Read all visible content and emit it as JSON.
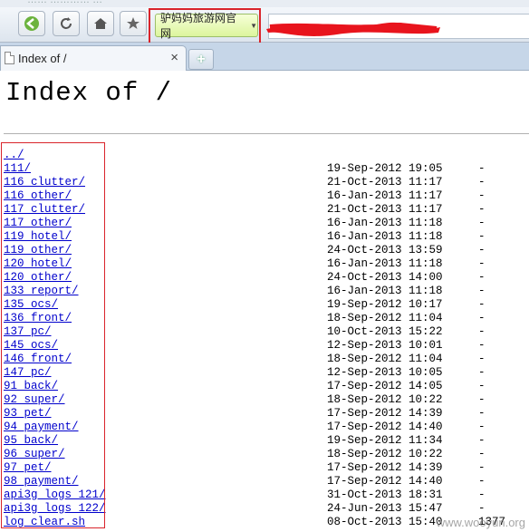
{
  "browser": {
    "window_title_fragment": "…… ………… …",
    "bookmark_label": "驴妈妈旅游网官网",
    "tab_title": "Index of /",
    "close_glyph": "×",
    "newtab_glyph": "+"
  },
  "page": {
    "heading": "Index of /",
    "entries": [
      {
        "name": "../",
        "date": "",
        "size": ""
      },
      {
        "name": "111/",
        "date": "19-Sep-2012 19:05",
        "size": "-"
      },
      {
        "name": "116_clutter/",
        "date": "21-Oct-2013 11:17",
        "size": "-"
      },
      {
        "name": "116_other/",
        "date": "16-Jan-2013 11:17",
        "size": "-"
      },
      {
        "name": "117_clutter/",
        "date": "21-Oct-2013 11:17",
        "size": "-"
      },
      {
        "name": "117_other/",
        "date": "16-Jan-2013 11:18",
        "size": "-"
      },
      {
        "name": "119_hotel/",
        "date": "16-Jan-2013 11:18",
        "size": "-"
      },
      {
        "name": "119_other/",
        "date": "24-Oct-2013 13:59",
        "size": "-"
      },
      {
        "name": "120_hotel/",
        "date": "16-Jan-2013 11:18",
        "size": "-"
      },
      {
        "name": "120_other/",
        "date": "24-Oct-2013 14:00",
        "size": "-"
      },
      {
        "name": "133_report/",
        "date": "16-Jan-2013 11:18",
        "size": "-"
      },
      {
        "name": "135_ocs/",
        "date": "19-Sep-2012 10:17",
        "size": "-"
      },
      {
        "name": "136_front/",
        "date": "18-Sep-2012 11:04",
        "size": "-"
      },
      {
        "name": "137_pc/",
        "date": "10-Oct-2013 15:22",
        "size": "-"
      },
      {
        "name": "145_ocs/",
        "date": "12-Sep-2013 10:01",
        "size": "-"
      },
      {
        "name": "146_front/",
        "date": "18-Sep-2012 11:04",
        "size": "-"
      },
      {
        "name": "147_pc/",
        "date": "12-Sep-2013 10:05",
        "size": "-"
      },
      {
        "name": "91_back/",
        "date": "17-Sep-2012 14:05",
        "size": "-"
      },
      {
        "name": "92_super/",
        "date": "18-Sep-2012 10:22",
        "size": "-"
      },
      {
        "name": "93_pet/",
        "date": "17-Sep-2012 14:39",
        "size": "-"
      },
      {
        "name": "94_payment/",
        "date": "17-Sep-2012 14:40",
        "size": "-"
      },
      {
        "name": "95_back/",
        "date": "19-Sep-2012 11:34",
        "size": "-"
      },
      {
        "name": "96_super/",
        "date": "18-Sep-2012 10:22",
        "size": "-"
      },
      {
        "name": "97_pet/",
        "date": "17-Sep-2012 14:39",
        "size": "-"
      },
      {
        "name": "98_payment/",
        "date": "17-Sep-2012 14:40",
        "size": "-"
      },
      {
        "name": "api3g_logs_121/",
        "date": "31-Oct-2013 18:31",
        "size": "-"
      },
      {
        "name": "api3g_logs_122/",
        "date": "24-Jun-2013 15:47",
        "size": "-"
      },
      {
        "name": "log_clear.sh",
        "date": "08-Oct-2013 15:40",
        "size": "1377"
      }
    ]
  },
  "watermark": "www.wooyun.org",
  "colors": {
    "highlight": "#d9242b",
    "link": "#0000cc",
    "redaction": "#e8141d"
  }
}
